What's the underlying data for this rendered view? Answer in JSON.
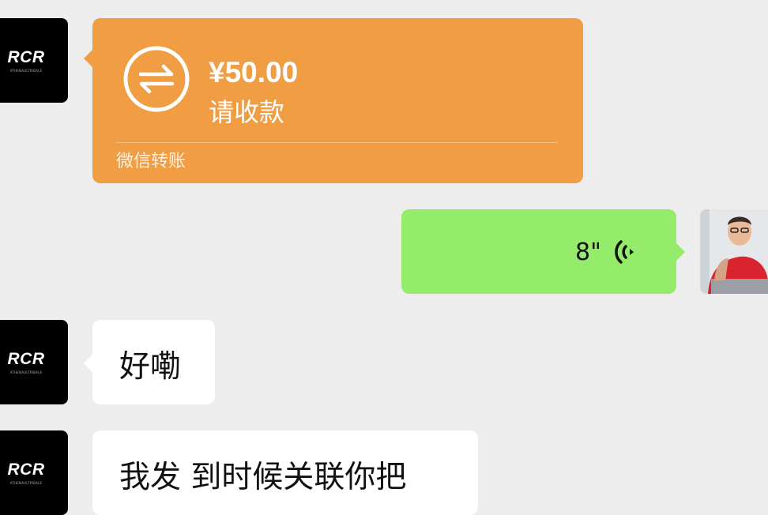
{
  "contact": {
    "avatar_logo": "RCR",
    "avatar_tagline": "ATHENAULTRIBALE"
  },
  "colors": {
    "transfer_bg": "#f09d43",
    "voice_bg": "#95eb6a",
    "incoming_bg": "#ffffff",
    "chat_bg": "#ededed"
  },
  "messages": {
    "transfer": {
      "amount": "¥50.00",
      "status": "请收款",
      "footer": "微信转账",
      "icon": "transfer-arrows-icon"
    },
    "voice": {
      "duration": "8\"",
      "icon": "voice-wave-icon"
    },
    "text1": {
      "text": "好嘞"
    },
    "text2": {
      "text": "我发 到时候关联你把"
    }
  }
}
